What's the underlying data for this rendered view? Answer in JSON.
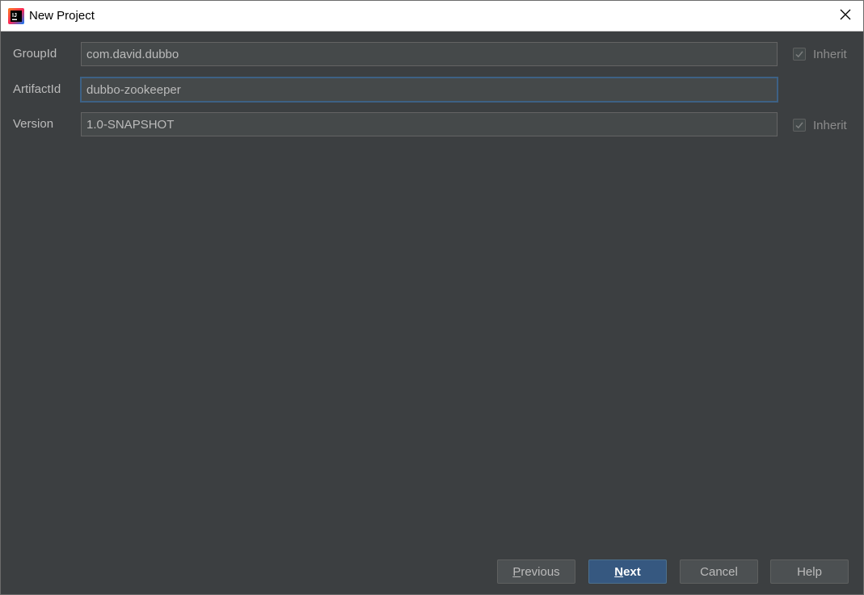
{
  "window": {
    "title": "New Project"
  },
  "form": {
    "group_id": {
      "label": "GroupId",
      "value": "com.david.dubbo",
      "inherit_label": "Inherit",
      "inherit_checked": true
    },
    "artifact_id": {
      "label": "ArtifactId",
      "value": "dubbo-zookeeper"
    },
    "version": {
      "label": "Version",
      "value": "1.0-SNAPSHOT",
      "inherit_label": "Inherit",
      "inherit_checked": true
    }
  },
  "buttons": {
    "previous_mnemonic": "P",
    "previous_rest": "revious",
    "next_mnemonic": "N",
    "next_rest": "ext",
    "cancel": "Cancel",
    "help": "Help"
  },
  "colors": {
    "background": "#3c3f41",
    "field_background": "#45494a",
    "focus_border": "#3d6185",
    "default_button": "#365880"
  },
  "icons": {
    "app": "intellij-idea-icon",
    "close": "close-icon",
    "checkmark": "checkmark-icon"
  }
}
